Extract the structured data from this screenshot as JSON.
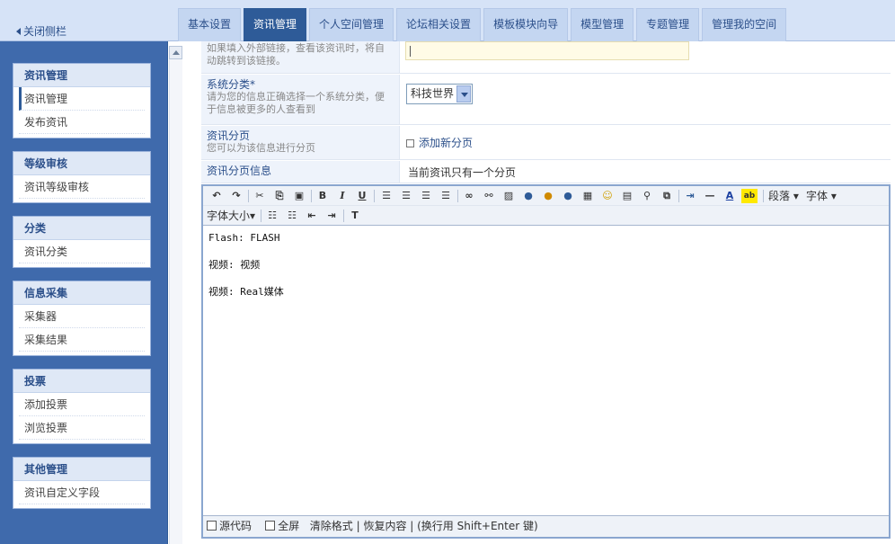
{
  "sidebar_toggle": "关闭侧栏",
  "tabs": [
    "基本设置",
    "资讯管理",
    "个人空间管理",
    "论坛相关设置",
    "模板模块向导",
    "模型管理",
    "专题管理",
    "管理我的空间"
  ],
  "active_tab": "资讯管理",
  "sidebar": [
    {
      "title": "资讯管理",
      "items": [
        "资讯管理",
        "发布资讯"
      ]
    },
    {
      "title": "等级审核",
      "items": [
        "资讯等级审核"
      ]
    },
    {
      "title": "分类",
      "items": [
        "资讯分类"
      ]
    },
    {
      "title": "信息采集",
      "items": [
        "采集器",
        "采集结果"
      ]
    },
    {
      "title": "投票",
      "items": [
        "添加投票",
        "浏览投票"
      ]
    },
    {
      "title": "其他管理",
      "items": [
        "资讯自定义字段"
      ]
    }
  ],
  "form": {
    "link_hint": "如果填入外部链接，查看该资讯时，将自动跳转到该链接。",
    "category_label": "系统分类*",
    "category_desc": "请为您的信息正确选择一个系统分类，便于信息被更多的人查看到",
    "category_value": "科技世界",
    "paging_label": "资讯分页",
    "paging_desc": "您可以为该信息进行分页",
    "add_page": "添加新分页",
    "paging_info_label": "资讯分页信息",
    "paging_info_value": "当前资讯只有一个分页"
  },
  "editor": {
    "toolbar": {
      "paragraph": "段落",
      "font": "字体",
      "font_size": "字体大小",
      "bold": "B",
      "italic": "I",
      "underline": "U"
    },
    "lines": [
      "Flash: FLASH",
      "视频: 视频",
      "视频: Real媒体"
    ],
    "footer": {
      "source": "源代码",
      "fullscreen": "全屏",
      "clear_format": "清除格式",
      "restore": "恢复内容",
      "hint": "(换行用 Shift+Enter 键)"
    }
  }
}
